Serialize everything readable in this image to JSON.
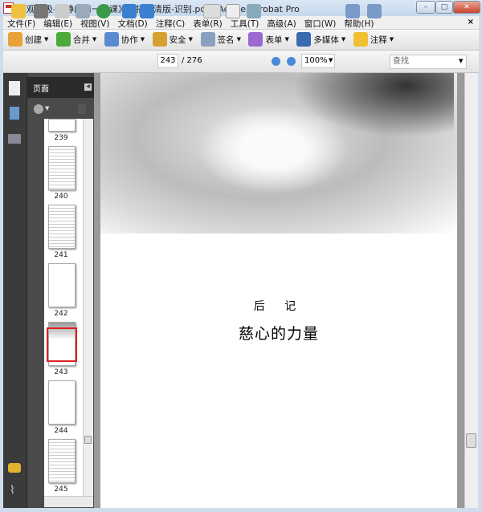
{
  "window": {
    "title": "《观呼吸-平静的第一堂课》扫描高清版-识别.pdf - Adobe Acrobat Pro",
    "min": "–",
    "max": "□",
    "close": "✕"
  },
  "menu": [
    "文件(F)",
    "编辑(E)",
    "视图(V)",
    "文档(D)",
    "注释(C)",
    "表单(R)",
    "工具(T)",
    "高级(A)",
    "窗口(W)",
    "帮助(H)"
  ],
  "menu_close": "×",
  "toolbar1": [
    {
      "label": "创建",
      "icon": "create-icon",
      "color": "#e8a23a"
    },
    {
      "label": "合并",
      "icon": "combine-icon",
      "color": "#4caa3a"
    },
    {
      "label": "协作",
      "icon": "collaborate-icon",
      "color": "#5a8ad0"
    },
    {
      "label": "安全",
      "icon": "lock-icon",
      "color": "#d4a030"
    },
    {
      "label": "签名",
      "icon": "pen-icon",
      "color": "#8aa0c0"
    },
    {
      "label": "表单",
      "icon": "form-icon",
      "color": "#9a6ad0"
    },
    {
      "label": "多媒体",
      "icon": "multimedia-icon",
      "color": "#3a6ab0"
    },
    {
      "label": "注释",
      "icon": "comment-icon",
      "color": "#f0c030"
    }
  ],
  "toolbar2": {
    "page": "243",
    "total": "/ 276",
    "zoom": "100%",
    "find_placeholder": "查找"
  },
  "panel": {
    "title": "页面"
  },
  "thumbs": [
    "239",
    "240",
    "241",
    "242",
    "243",
    "244",
    "245"
  ],
  "page": {
    "heading": "后 记",
    "title": "慈心的力量"
  }
}
